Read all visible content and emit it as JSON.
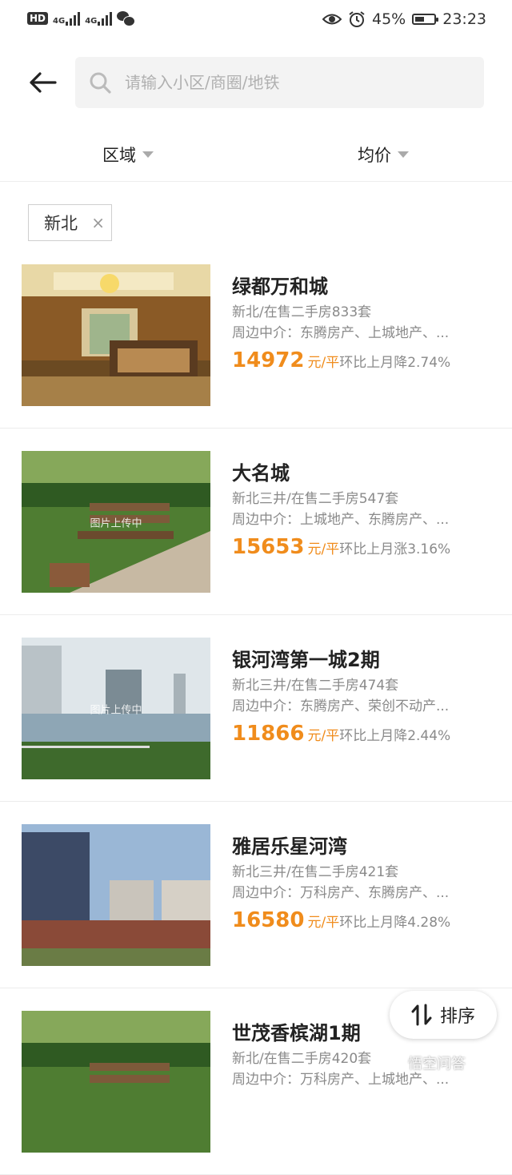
{
  "status_bar": {
    "hd": "HD",
    "net1": "4G",
    "net2": "4G",
    "battery": "45%",
    "time": "23:23"
  },
  "search": {
    "placeholder": "请输入小区/商圈/地铁"
  },
  "filters": {
    "area_label": "区域",
    "price_label": "均价"
  },
  "active_tag": {
    "label": "新北",
    "close": "×"
  },
  "listings": [
    {
      "name": "绿都万和城",
      "meta": "新北/在售二手房833套",
      "agents": "周边中介：东腾房产、上城地产、...",
      "price": "14972",
      "unit": "元/平",
      "change": "环比上月降2.74%",
      "image": "bedroom-interior"
    },
    {
      "name": "大名城",
      "meta": "新北三井/在售二手房547套",
      "agents": "周边中介：上城地产、东腾房产、...",
      "price": "15653",
      "unit": "元/平",
      "change": "环比上月涨3.16%",
      "image": "garden-bench",
      "image_caption": "图片上传中"
    },
    {
      "name": "银河湾第一城2期",
      "meta": "新北三井/在售二手房474套",
      "agents": "周边中介：东腾房产、荣创不动产...",
      "price": "11866",
      "unit": "元/平",
      "change": "环比上月降2.44%",
      "image": "river-city",
      "image_caption": "图片上传中"
    },
    {
      "name": "雅居乐星河湾",
      "meta": "新北三井/在售二手房421套",
      "agents": "周边中介：万科房产、东腾房产、...",
      "price": "16580",
      "unit": "元/平",
      "change": "环比上月降4.28%",
      "image": "tower-buildings"
    },
    {
      "name": "世茂香槟湖1期",
      "meta": "新北/在售二手房420套",
      "agents": "周边中介：万科房产、上城地产、...",
      "price": "",
      "unit": "",
      "change": "",
      "image": "garden-bench"
    }
  ],
  "sort_button": {
    "label": "排序"
  },
  "watermark": "悟空问答",
  "colors": {
    "price": "#f08c1c",
    "secondary_text": "#8a8a8a"
  }
}
